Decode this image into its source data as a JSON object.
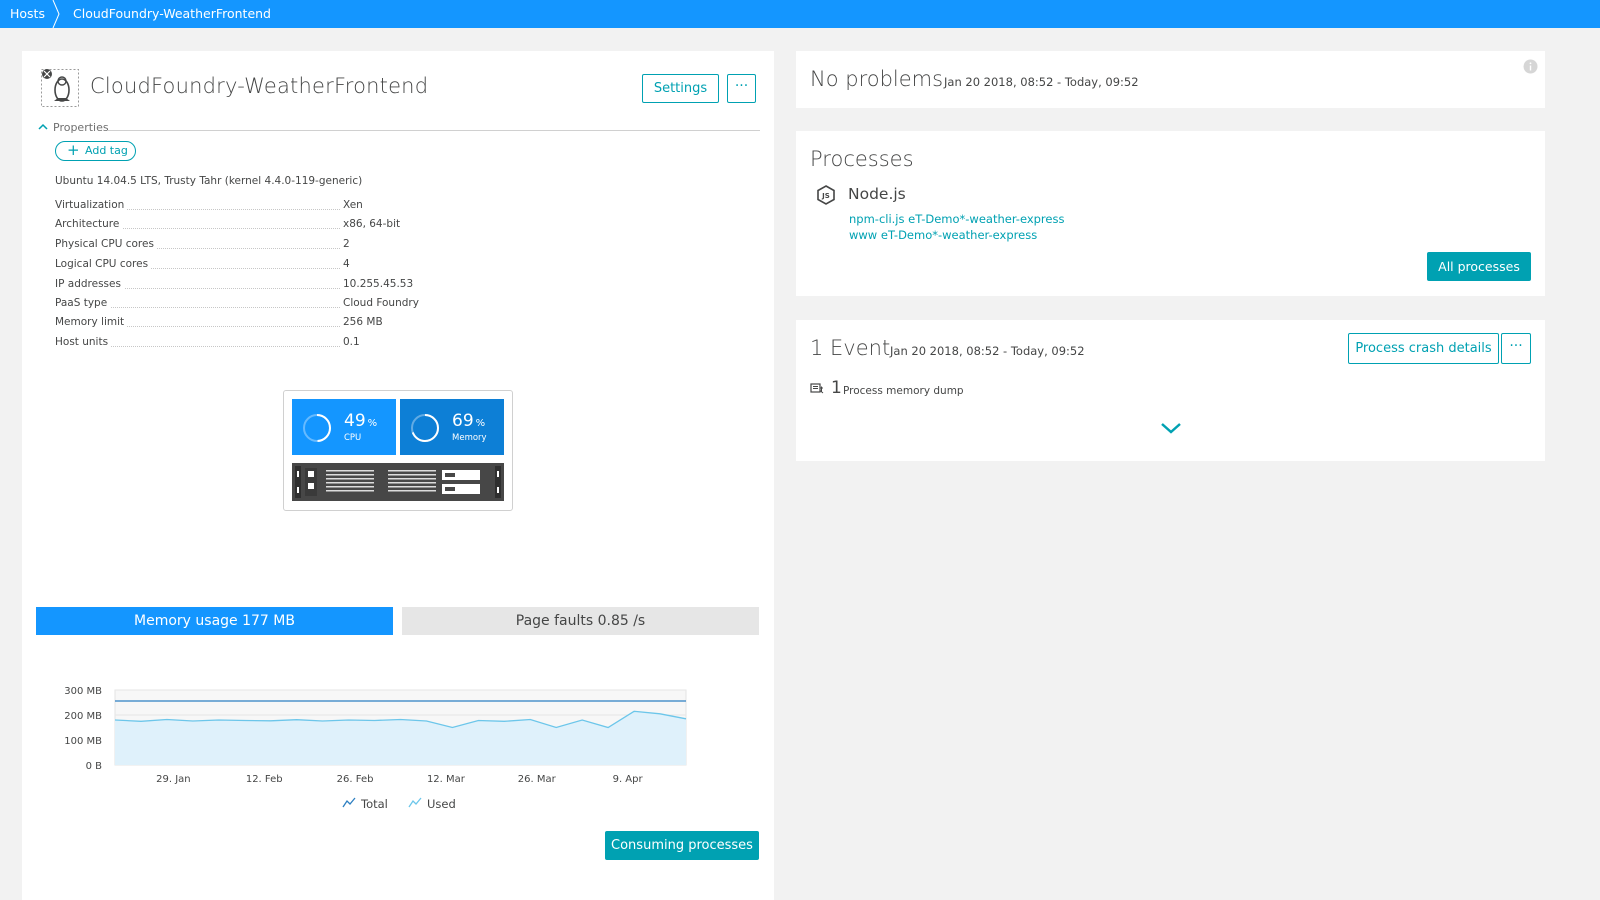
{
  "breadcrumb": {
    "root": "Hosts",
    "current": "CloudFoundry-WeatherFrontend"
  },
  "host": {
    "title": "CloudFoundry-WeatherFrontend",
    "settings_label": "Settings",
    "more_label": "···",
    "properties_label": "Properties",
    "add_tag_label": "Add tag",
    "add_tag_icon": "+",
    "os": "Ubuntu 14.04.5 LTS, Trusty Tahr (kernel 4.4.0-119-generic)",
    "properties": [
      {
        "key": "Virtualization",
        "value": "Xen"
      },
      {
        "key": "Architecture",
        "value": "x86, 64-bit"
      },
      {
        "key": "Physical CPU cores",
        "value": "2"
      },
      {
        "key": "Logical CPU cores",
        "value": "4"
      },
      {
        "key": "IP addresses",
        "value": "10.255.45.53"
      },
      {
        "key": "PaaS type",
        "value": "Cloud Foundry"
      },
      {
        "key": "Memory limit",
        "value": "256 MB"
      },
      {
        "key": "Host units",
        "value": "0.1"
      }
    ],
    "cpu": {
      "value": "49",
      "unit": "%",
      "label": "CPU",
      "fraction": 0.49
    },
    "memory": {
      "value": "69",
      "unit": "%",
      "label": "Memory",
      "fraction": 0.69
    }
  },
  "metric_tabs": {
    "memory": "Memory usage 177 MB",
    "page_faults": "Page faults 0.85 /s"
  },
  "chart_data": {
    "type": "area",
    "title": "",
    "xlabel": "",
    "ylabel": "",
    "ylim": [
      0,
      300
    ],
    "y_ticks": [
      "300 MB",
      "200 MB",
      "100 MB",
      "0 B"
    ],
    "x_ticks": [
      "29. Jan",
      "12. Feb",
      "26. Feb",
      "12. Mar",
      "26. Mar",
      "9. Apr"
    ],
    "x": [
      "2018-01-20",
      "2018-01-24",
      "2018-01-28",
      "2018-02-01",
      "2018-02-05",
      "2018-02-09",
      "2018-02-13",
      "2018-02-17",
      "2018-02-21",
      "2018-02-25",
      "2018-03-01",
      "2018-03-05",
      "2018-03-09",
      "2018-03-13",
      "2018-03-17",
      "2018-03-21",
      "2018-03-25",
      "2018-03-29",
      "2018-04-02",
      "2018-04-06",
      "2018-04-10",
      "2018-04-14",
      "2018-04-18"
    ],
    "series": [
      {
        "name": "Total",
        "values": [
          256,
          256,
          256,
          256,
          256,
          256,
          256,
          256,
          256,
          256,
          256,
          256,
          256,
          256,
          256,
          256,
          256,
          256,
          256,
          256,
          256,
          256,
          256
        ]
      },
      {
        "name": "Used",
        "values": [
          180,
          175,
          182,
          176,
          180,
          178,
          177,
          181,
          176,
          180,
          178,
          182,
          176,
          150,
          178,
          175,
          182,
          150,
          180,
          150,
          215,
          205,
          185
        ]
      }
    ],
    "legend": "bottom",
    "grid": true
  },
  "legend": {
    "total": "Total",
    "used": "Used"
  },
  "consuming_label": "Consuming processes",
  "problems": {
    "title": "No problems",
    "range": "Jan 20 2018, 08:52 - Today, 09:52"
  },
  "processes": {
    "title": "Processes",
    "group": "Node.js",
    "items": [
      "npm-cli.js eT-Demo*-weather-express",
      "www eT-Demo*-weather-express"
    ],
    "all_label": "All processes"
  },
  "events": {
    "title": "1 Event",
    "range": "Jan 20 2018, 08:52 - Today, 09:52",
    "crash_label": "Process crash details",
    "more_label": "···",
    "count": "1",
    "item_label": "Process memory dump"
  },
  "colors": {
    "accent": "#1496ff",
    "teal": "#00a1b2",
    "memory_tile": "#0d7fd6"
  }
}
